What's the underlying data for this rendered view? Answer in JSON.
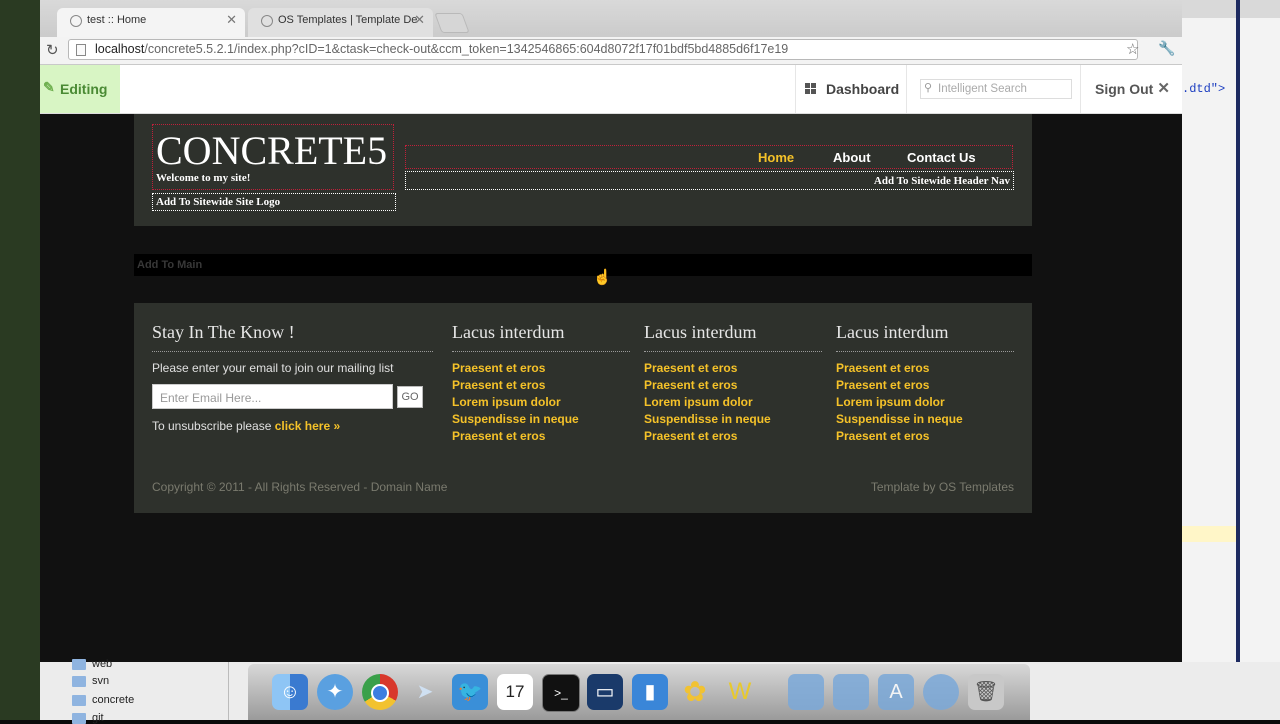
{
  "browser": {
    "tabs": [
      {
        "title": "test :: Home"
      },
      {
        "title": "OS Templates | Template De"
      }
    ],
    "url_host": "localhost",
    "url_path": "/concrete5.5.2.1/index.php?cID=1&ctask=check-out&ccm_token=1342546865:604d8072f17f01bdf5bd4885d6f17e19"
  },
  "c5_toolbar": {
    "editing_label": "Editing",
    "dashboard_label": "Dashboard",
    "search_placeholder": "Intelligent Search",
    "signout_label": "Sign Out"
  },
  "header": {
    "logo": "CONCRETE5",
    "tagline": "Welcome to my site!",
    "add_logo": "Add To Sitewide Site Logo",
    "nav": [
      "Home",
      "About",
      "Contact Us"
    ],
    "add_nav": "Add To Sitewide Header Nav"
  },
  "main": {
    "add_main": "Add To Main"
  },
  "footer": {
    "col1": {
      "heading": "Stay In The Know !",
      "text": "Please enter your email to join our mailing list",
      "email_placeholder": "Enter Email Here...",
      "go_label": "GO",
      "unsub_text": "To unsubscribe please ",
      "unsub_link": "click here »"
    },
    "columns": [
      {
        "heading": "Lacus interdum",
        "links": [
          "Praesent et eros",
          "Praesent et eros",
          "Lorem ipsum dolor",
          "Suspendisse in neque",
          "Praesent et eros"
        ]
      },
      {
        "heading": "Lacus interdum",
        "links": [
          "Praesent et eros",
          "Praesent et eros",
          "Lorem ipsum dolor",
          "Suspendisse in neque",
          "Praesent et eros"
        ]
      },
      {
        "heading": "Lacus interdum",
        "links": [
          "Praesent et eros",
          "Praesent et eros",
          "Lorem ipsum dolor",
          "Suspendisse in neque",
          "Praesent et eros"
        ]
      }
    ],
    "copyright": "Copyright © 2011 - All Rights Reserved - Domain Name",
    "credit": "Template by OS Templates"
  },
  "side_editor": {
    "code_fragment": ".dtd\">"
  },
  "finder": {
    "items": [
      "web",
      "svn",
      "concrete",
      "git"
    ]
  },
  "dock": {
    "apps": [
      "finder-icon",
      "safari-icon",
      "chrome-icon",
      "mail-icon",
      "twitter-icon",
      "calendar-icon",
      "terminal-icon",
      "display-icon",
      "phone-icon",
      "flower-icon",
      "textwrangler-icon",
      "folder-icon",
      "folder-icon",
      "applications-icon",
      "downloads-icon",
      "trash-icon"
    ],
    "calendar_day": "17"
  },
  "colors": {
    "accent_yellow": "#f5c229",
    "panel_bg": "#2e312c",
    "editing_green": "#d8f5c4"
  }
}
